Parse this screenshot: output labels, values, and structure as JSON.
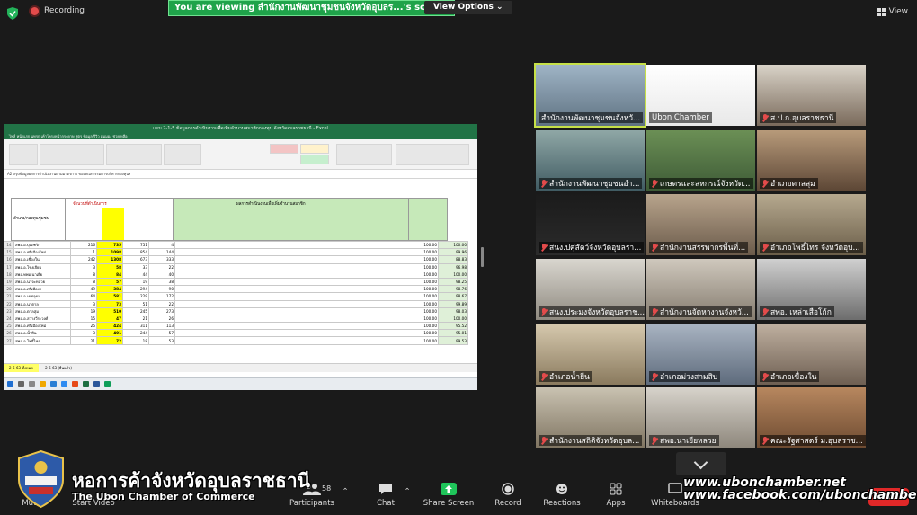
{
  "topbar": {
    "recording_label": "Recording",
    "viewing_banner": "You are viewing สำนักงานพัฒนาชุมชนจังหวัดอุบลร...'s screen",
    "view_options_label": "View Options",
    "view_label": "View"
  },
  "excel": {
    "title": "แบบ 2-1-5 ข้อมูลการดำเนินงานเพื่อเพิ่มจำนวนสมาชิกกองทุน จังหวัดอุบลราชธานี - Excel",
    "menu": "ไฟล์   หน้าแรก   แทรก   เค้าโครงหน้ากระดาษ   สูตร   ข้อมูล   รีวิว   มุมมอง   ช่วยเหลือ",
    "formula": "A2   สรุปข้อมูลผลการดำเนินงานตามมาตรการ ของคณะกรรมการบริหารกองทุนฯ",
    "header_left": "อำเภอ/กองทุนชุมชน",
    "header_target": "จำนวนที่ดำเนินการ",
    "header_group": "ผลการดำเนินงานเพื่อเพิ่มจำนวนสมาชิก",
    "rows": [
      {
        "n": "14",
        "name": "สพอ.อ.บุณฑริก",
        "a": "216",
        "b": "735",
        "c": "751",
        "d": "4",
        "e": "100.00",
        "f": "100.00"
      },
      {
        "n": "15",
        "name": "สพอ.อ.ศรีเมืองใหม่",
        "a": "1",
        "b": "1098",
        "c": "854",
        "d": "144",
        "e": "100.00",
        "f": "99.96"
      },
      {
        "n": "16",
        "name": "สพอ.อ.เขื่องใน",
        "a": "242",
        "b": "1308",
        "c": "673",
        "d": "333",
        "e": "100.00",
        "f": "88.83"
      },
      {
        "n": "17",
        "name": "สพอ.อ.โขงเจียม",
        "a": "3",
        "b": "58",
        "c": "33",
        "d": "22",
        "e": "100.00",
        "f": "96.98"
      },
      {
        "n": "18",
        "name": "สพอ.ทพอ.นาเยีย",
        "a": "8",
        "b": "84",
        "c": "44",
        "d": "40",
        "e": "100.00",
        "f": "100.00"
      },
      {
        "n": "19",
        "name": "สพอ.อ.นาจะหลวย",
        "a": "8",
        "b": "57",
        "c": "19",
        "d": "38",
        "e": "100.00",
        "f": "98.25"
      },
      {
        "n": "20",
        "name": "สพอ.อ.ศรีเมืองฯ",
        "a": "49",
        "b": "384",
        "c": "294",
        "d": "90",
        "e": "100.00",
        "f": "98.76"
      },
      {
        "n": "21",
        "name": "สพอ.อ.เดชอุดม",
        "a": "64",
        "b": "581",
        "c": "229",
        "d": "172",
        "e": "100.00",
        "f": "98.67"
      },
      {
        "n": "22",
        "name": "สพอ.อ.นาตาล",
        "a": "3",
        "b": "73",
        "c": "51",
        "d": "22",
        "e": "100.00",
        "f": "99.89"
      },
      {
        "n": "23",
        "name": "สพอ.อ.ตาลสุม",
        "a": "19",
        "b": "510",
        "c": "245",
        "d": "273",
        "e": "100.00",
        "f": "98.03"
      },
      {
        "n": "24",
        "name": "สพอ.อ.สว่างวีระวงศ์",
        "a": "15",
        "b": "47",
        "c": "21",
        "d": "26",
        "e": "100.00",
        "f": "100.00"
      },
      {
        "n": "25",
        "name": "สพอ.อ.ศรีเมืองใหม่",
        "a": "25",
        "b": "424",
        "c": "311",
        "d": "113",
        "e": "100.00",
        "f": "95.52"
      },
      {
        "n": "26",
        "name": "สพอ.อ.น้ำยืน",
        "a": "3",
        "b": "401",
        "c": "244",
        "d": "57",
        "e": "100.00",
        "f": "95.01"
      },
      {
        "n": "27",
        "name": "สพอ.อ.โพธิ์ไทร",
        "a": "21",
        "b": "72",
        "c": "18",
        "d": "53",
        "e": "100.00",
        "f": "99.53"
      }
    ],
    "tabs": [
      "2-6-63 ทั้งหมด",
      "2-6-63 (ยื่นแล้ว)"
    ]
  },
  "tiles": [
    {
      "label": "สำนักงานพัฒนาชุมชนจังหวั...",
      "muted": false,
      "active": true
    },
    {
      "label": "Ubon Chamber",
      "muted": false,
      "active": false
    },
    {
      "label": "ส.ป.ก.อุบลราชธานี",
      "muted": true,
      "active": false
    },
    {
      "label": "สำนักงานพัฒนาชุมชนอำ...",
      "muted": true,
      "active": false
    },
    {
      "label": "เกษตรและสหกรณ์จังหวัด...",
      "muted": true,
      "active": false
    },
    {
      "label": "อำเภอตาลสุม",
      "muted": true,
      "active": false
    },
    {
      "label": "สนง.ปศุสัตว์จังหวัดอุบลรา...",
      "muted": true,
      "active": false
    },
    {
      "label": "สำนักงานสรรพากรพื้นที่...",
      "muted": true,
      "active": false
    },
    {
      "label": "อำเภอโพธิ์ไทร จังหวัดอุบ...",
      "muted": true,
      "active": false
    },
    {
      "label": "สนง.ประมงจังหวัดอุบลราช...",
      "muted": true,
      "active": false
    },
    {
      "label": "สำนักงานจัดหางานจังหวั...",
      "muted": true,
      "active": false
    },
    {
      "label": "สพอ. เหล่าเสือโก้ก",
      "muted": true,
      "active": false
    },
    {
      "label": "อำเภอน้ำยืน",
      "muted": true,
      "active": false
    },
    {
      "label": "อำเภอม่วงสามสิบ",
      "muted": true,
      "active": false
    },
    {
      "label": "อำเภอเขื่องใน",
      "muted": true,
      "active": false
    },
    {
      "label": "สำนักงานสถิติจังหวัดอุบล...",
      "muted": true,
      "active": false
    },
    {
      "label": "สพอ.นาเยียหลวย",
      "muted": true,
      "active": false
    },
    {
      "label": "คณะรัฐศาสตร์ ม.อุบลราช...",
      "muted": true,
      "active": false
    }
  ],
  "toolbar": {
    "mute": "Mute",
    "start_video": "Start Video",
    "participants": "Participants",
    "participants_count": "58",
    "chat": "Chat",
    "share_screen": "Share Screen",
    "record": "Record",
    "reactions": "Reactions",
    "apps": "Apps",
    "whiteboards": "Whiteboards",
    "end": "End"
  },
  "branding": {
    "thai_name": "หอการค้าจังหวัดอุบลราชธานี",
    "english_name": "The Ubon Chamber of Commerce",
    "website": "www.ubonchamber.net",
    "facebook": "www.facebook.com/ubonchamber"
  },
  "colors": {
    "accent_green": "#1fa34a",
    "active_tile_border": "#c6e047",
    "end_red": "#e02828",
    "excel_green": "#217346"
  }
}
